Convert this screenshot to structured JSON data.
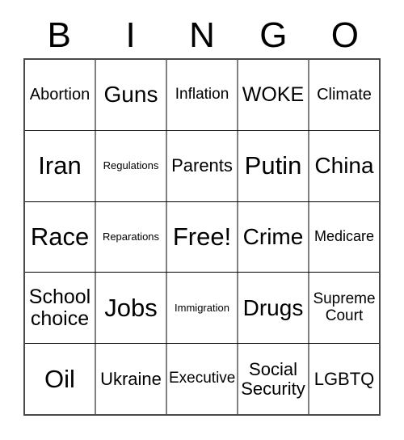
{
  "card": {
    "header_letters": [
      "B",
      "I",
      "N",
      "G",
      "O"
    ],
    "columns": 5,
    "rows": 5,
    "background_color": "#ffffff",
    "text_color": "#000000",
    "outer_border_color": "#4a4a4a",
    "row_divider_color": "#000000",
    "column_divider_color": "#808080",
    "free_space": "Free!",
    "cells": [
      [
        {
          "label": "Abortion",
          "size": "fs-lg"
        },
        {
          "label": "Guns",
          "size": "fs-3xl"
        },
        {
          "label": "Inflation",
          "size": "fs-md2"
        },
        {
          "label": "WOKE",
          "size": "fs-2xl"
        },
        {
          "label": "Climate",
          "size": "fs-lg"
        }
      ],
      [
        {
          "label": "Iran",
          "size": "fs-4xl"
        },
        {
          "label": "Regulations",
          "size": "fs-xs"
        },
        {
          "label": "Parents",
          "size": "fs-xl"
        },
        {
          "label": "Putin",
          "size": "fs-4xl"
        },
        {
          "label": "China",
          "size": "fs-3xl"
        }
      ],
      [
        {
          "label": "Race",
          "size": "fs-4xl"
        },
        {
          "label": "Reparations",
          "size": "fs-xs"
        },
        {
          "label": "Free!",
          "size": "fs-4xl"
        },
        {
          "label": "Crime",
          "size": "fs-3xl"
        },
        {
          "label": "Medicare",
          "size": "fs-md"
        }
      ],
      [
        {
          "label": "School\nchoice",
          "size": "fs-2xl"
        },
        {
          "label": "Jobs",
          "size": "fs-4xl"
        },
        {
          "label": "Immigration",
          "size": "fs-xs"
        },
        {
          "label": "Drugs",
          "size": "fs-3xl"
        },
        {
          "label": "Supreme\nCourt",
          "size": "fs-md2"
        }
      ],
      [
        {
          "label": "Oil",
          "size": "fs-4xl"
        },
        {
          "label": "Ukraine",
          "size": "fs-xl"
        },
        {
          "label": "Executive",
          "size": "fs-md2"
        },
        {
          "label": "Social\nSecurity",
          "size": "fs-xl"
        },
        {
          "label": "LGBTQ",
          "size": "fs-xl"
        }
      ]
    ]
  }
}
